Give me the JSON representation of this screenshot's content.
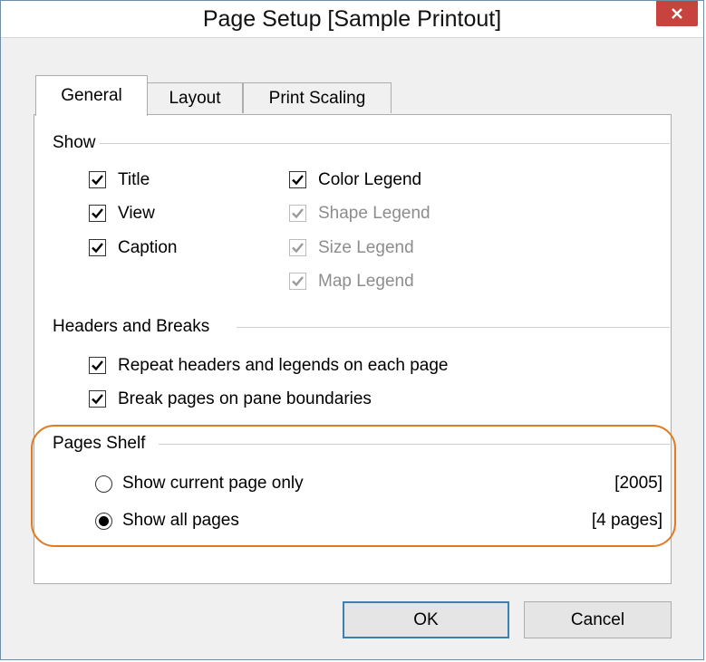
{
  "window": {
    "title": "Page Setup [Sample Printout]",
    "close_symbol": "×"
  },
  "tabs": [
    {
      "label": "General",
      "active": true
    },
    {
      "label": "Layout",
      "active": false
    },
    {
      "label": "Print Scaling",
      "active": false
    }
  ],
  "show_group": {
    "label": "Show",
    "left_items": [
      {
        "label": "Title",
        "checked": true,
        "enabled": true
      },
      {
        "label": "View",
        "checked": true,
        "enabled": true
      },
      {
        "label": "Caption",
        "checked": true,
        "enabled": true
      }
    ],
    "right_items": [
      {
        "label": "Color Legend",
        "checked": true,
        "enabled": true
      },
      {
        "label": "Shape Legend",
        "checked": true,
        "enabled": false
      },
      {
        "label": "Size Legend",
        "checked": true,
        "enabled": false
      },
      {
        "label": "Map Legend",
        "checked": true,
        "enabled": false
      }
    ]
  },
  "headers_group": {
    "label": "Headers and Breaks",
    "items": [
      {
        "label": "Repeat headers and legends on each page",
        "checked": true
      },
      {
        "label": "Break pages on pane boundaries",
        "checked": true
      }
    ]
  },
  "pages_shelf": {
    "label": "Pages Shelf",
    "options": [
      {
        "label": "Show current page only",
        "value": "[2005]",
        "selected": false
      },
      {
        "label": "Show all pages",
        "value": "[4 pages]",
        "selected": true
      }
    ]
  },
  "highlight_color": "#e07b22",
  "buttons": {
    "ok": "OK",
    "cancel": "Cancel"
  }
}
